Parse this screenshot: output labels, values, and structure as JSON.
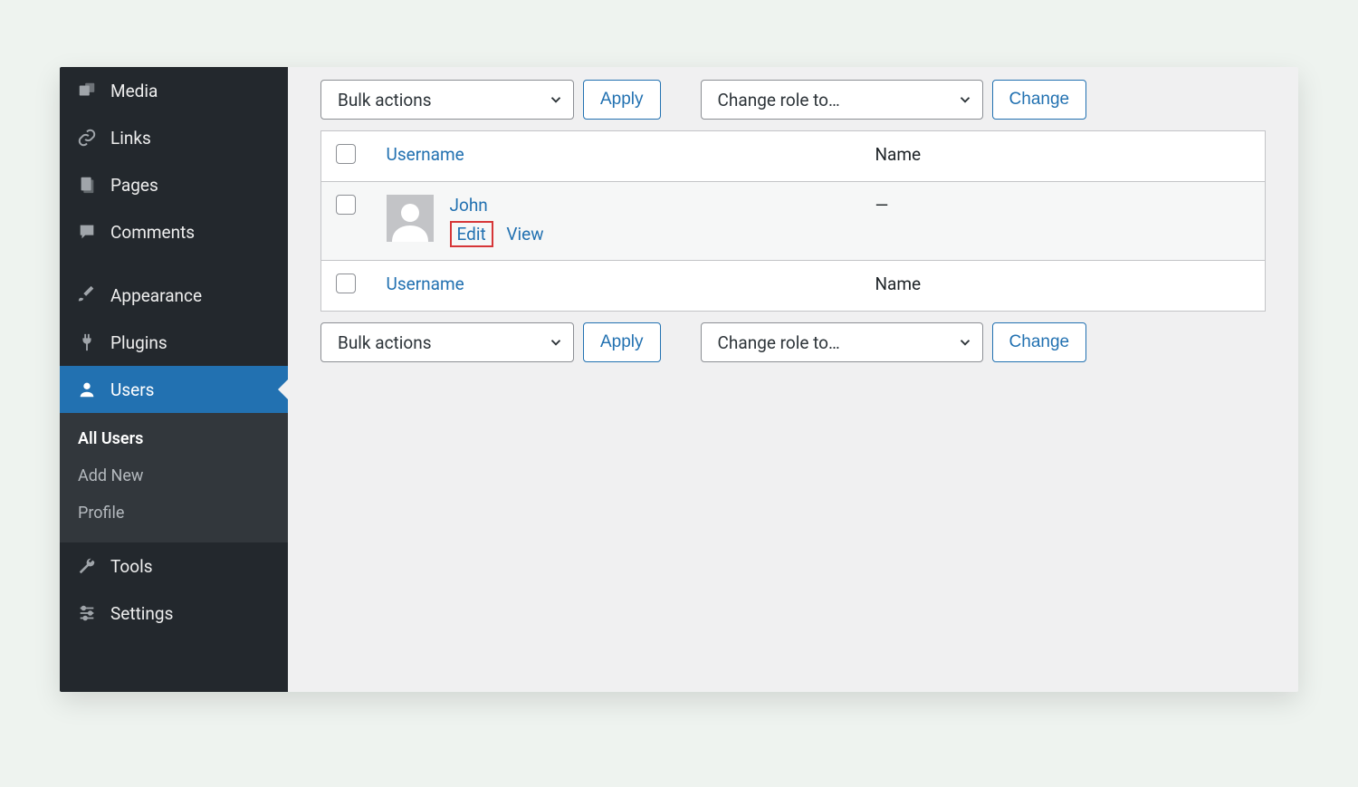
{
  "sidebar": {
    "items": [
      {
        "label": "Media",
        "icon": "media-icon"
      },
      {
        "label": "Links",
        "icon": "link-icon"
      },
      {
        "label": "Pages",
        "icon": "pages-icon"
      },
      {
        "label": "Comments",
        "icon": "comment-icon"
      },
      {
        "label": "Appearance",
        "icon": "brush-icon"
      },
      {
        "label": "Plugins",
        "icon": "plug-icon"
      },
      {
        "label": "Users",
        "icon": "user-icon",
        "active": true
      },
      {
        "label": "Tools",
        "icon": "wrench-icon"
      },
      {
        "label": "Settings",
        "icon": "sliders-icon"
      }
    ],
    "submenu": [
      {
        "label": "All Users",
        "current": true
      },
      {
        "label": "Add New"
      },
      {
        "label": "Profile"
      }
    ]
  },
  "toolbar": {
    "bulk_label": "Bulk actions",
    "apply_label": "Apply",
    "role_label": "Change role to…",
    "change_label": "Change"
  },
  "table": {
    "headers": {
      "username": "Username",
      "name": "Name"
    },
    "rows": [
      {
        "username": "John",
        "name": "—",
        "actions": {
          "edit": "Edit",
          "view": "View"
        }
      }
    ]
  }
}
